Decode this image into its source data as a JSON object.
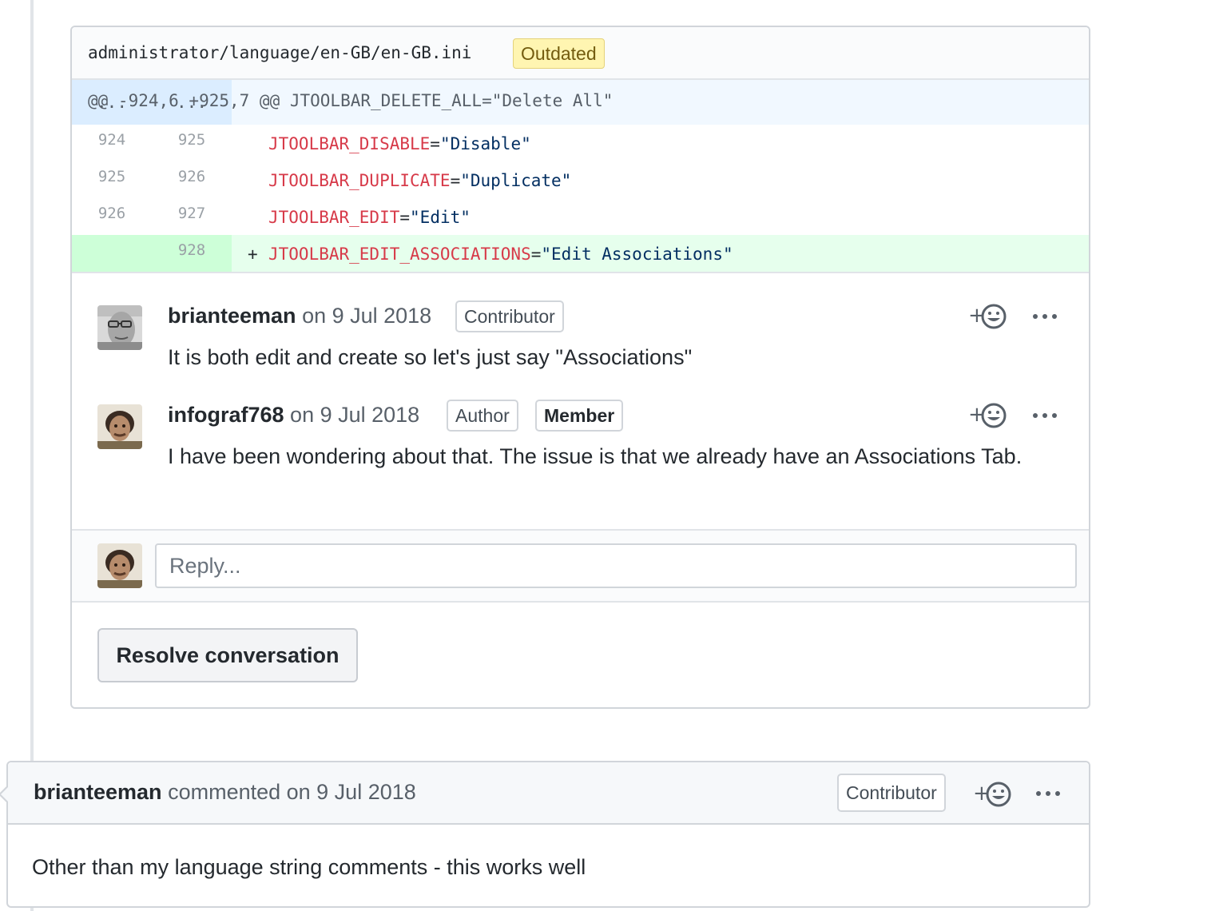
{
  "review": {
    "file_path": "administrator/language/en-GB/en-GB.ini",
    "outdated_label": "Outdated",
    "hunk": {
      "old_num": "...",
      "new_num": "...",
      "text": "@@ -924,6 +925,7 @@ JTOOLBAR_DELETE_ALL=\"Delete All\""
    },
    "lines": [
      {
        "old": "924",
        "new": "925",
        "key": "JTOOLBAR_DISABLE",
        "eq": "=",
        "value": "\"Disable\""
      },
      {
        "old": "925",
        "new": "926",
        "key": "JTOOLBAR_DUPLICATE",
        "eq": "=",
        "value": "\"Duplicate\""
      },
      {
        "old": "926",
        "new": "927",
        "key": "JTOOLBAR_EDIT",
        "eq": "=",
        "value": "\"Edit\""
      }
    ],
    "added_line": {
      "new": "928",
      "sign": "+",
      "key": "JTOOLBAR_EDIT_ASSOCIATIONS",
      "eq": "=",
      "value": "\"Edit Associations\""
    },
    "comments": [
      {
        "author": "brianteeman",
        "meta": " on 9 Jul 2018",
        "badges": [
          "Contributor"
        ],
        "body": "It is both edit and create so let's just say \"Associations\""
      },
      {
        "author": "infograf768",
        "meta": " on 9 Jul 2018",
        "badges": [
          "Author",
          "Member"
        ],
        "body": "I have been wondering about that. The issue is that we already have an Associations Tab."
      }
    ],
    "reply_placeholder": "Reply...",
    "resolve_label": "Resolve conversation"
  },
  "timeline_comment": {
    "author": "brianteeman",
    "meta": " commented on 9 Jul 2018",
    "badge": "Contributor",
    "body": "Other than my language string comments - this works well"
  },
  "colors": {
    "key": "#d73a49",
    "string": "#032f62",
    "added_bg": "#e6ffed",
    "hunk_bg": "#f1f8ff",
    "outdated_bg": "#fff5b1"
  },
  "icons": [
    "add-reaction-icon",
    "more-options-icon",
    "avatar-brianteeman",
    "avatar-infograf768"
  ]
}
